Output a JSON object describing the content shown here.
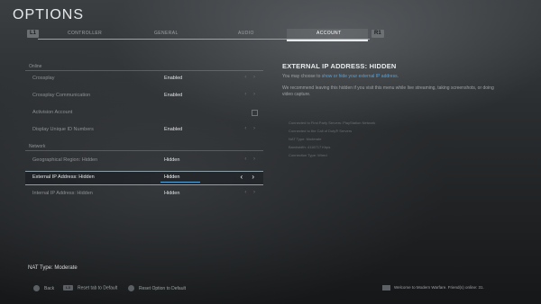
{
  "page_title": "OPTIONS",
  "tabs": {
    "left_button": "L1",
    "right_button": "R1",
    "items": [
      {
        "label": "CONTROLLER",
        "active": false
      },
      {
        "label": "GENERAL",
        "active": false
      },
      {
        "label": "AUDIO",
        "active": false
      },
      {
        "label": "ACCOUNT",
        "active": true
      }
    ]
  },
  "sections": [
    {
      "header": "Online",
      "rows": [
        {
          "label": "Crossplay",
          "value": "Enabled",
          "control": "arrows"
        },
        {
          "label": "Crossplay Communication",
          "value": "Enabled",
          "control": "arrows"
        },
        {
          "label": "Activision Account",
          "value": "",
          "control": "external-link"
        },
        {
          "label": "Display Unique ID Numbers",
          "value": "Enabled",
          "control": "arrows"
        }
      ]
    },
    {
      "header": "Network",
      "rows": [
        {
          "label": "Geographical Region: Hidden",
          "value": "Hidden",
          "control": "arrows"
        },
        {
          "label": "External IP Address: Hidden",
          "value": "Hidden",
          "control": "arrows",
          "selected": true
        },
        {
          "label": "Internal IP Address: Hidden",
          "value": "Hidden",
          "control": "arrows"
        }
      ]
    }
  ],
  "arrows_glyph": "‹ ›",
  "detail_panel": {
    "title": "EXTERNAL IP ADDRESS: HIDDEN",
    "line1_prefix": "You may choose to ",
    "line1_link": "show or hide your external IP address",
    "line1_suffix": ".",
    "line2": "We recommend leaving this hidden if you visit this menu while live streaming, taking screenshots, or doing video capture."
  },
  "connection_info": [
    "Connected to First Party Servers: PlayStation Network",
    "Connected to the Call of Duty® Servers",
    "NAT Type: Moderate",
    "Bandwidth: 4118717 Kbps",
    "Connection Type: Wired"
  ],
  "nat_status": "NAT Type: Moderate",
  "footer": {
    "back": "Back",
    "reset_tab_button": "L3",
    "reset_tab": "Reset tab to Default",
    "reset_option": "Reset Option to Default",
    "welcome": "Welcome to Modern Warfare. Friend(s) online: 31."
  },
  "colors": {
    "accent_link": "#4fa3e0",
    "selection_bar": "#5aa7df"
  }
}
